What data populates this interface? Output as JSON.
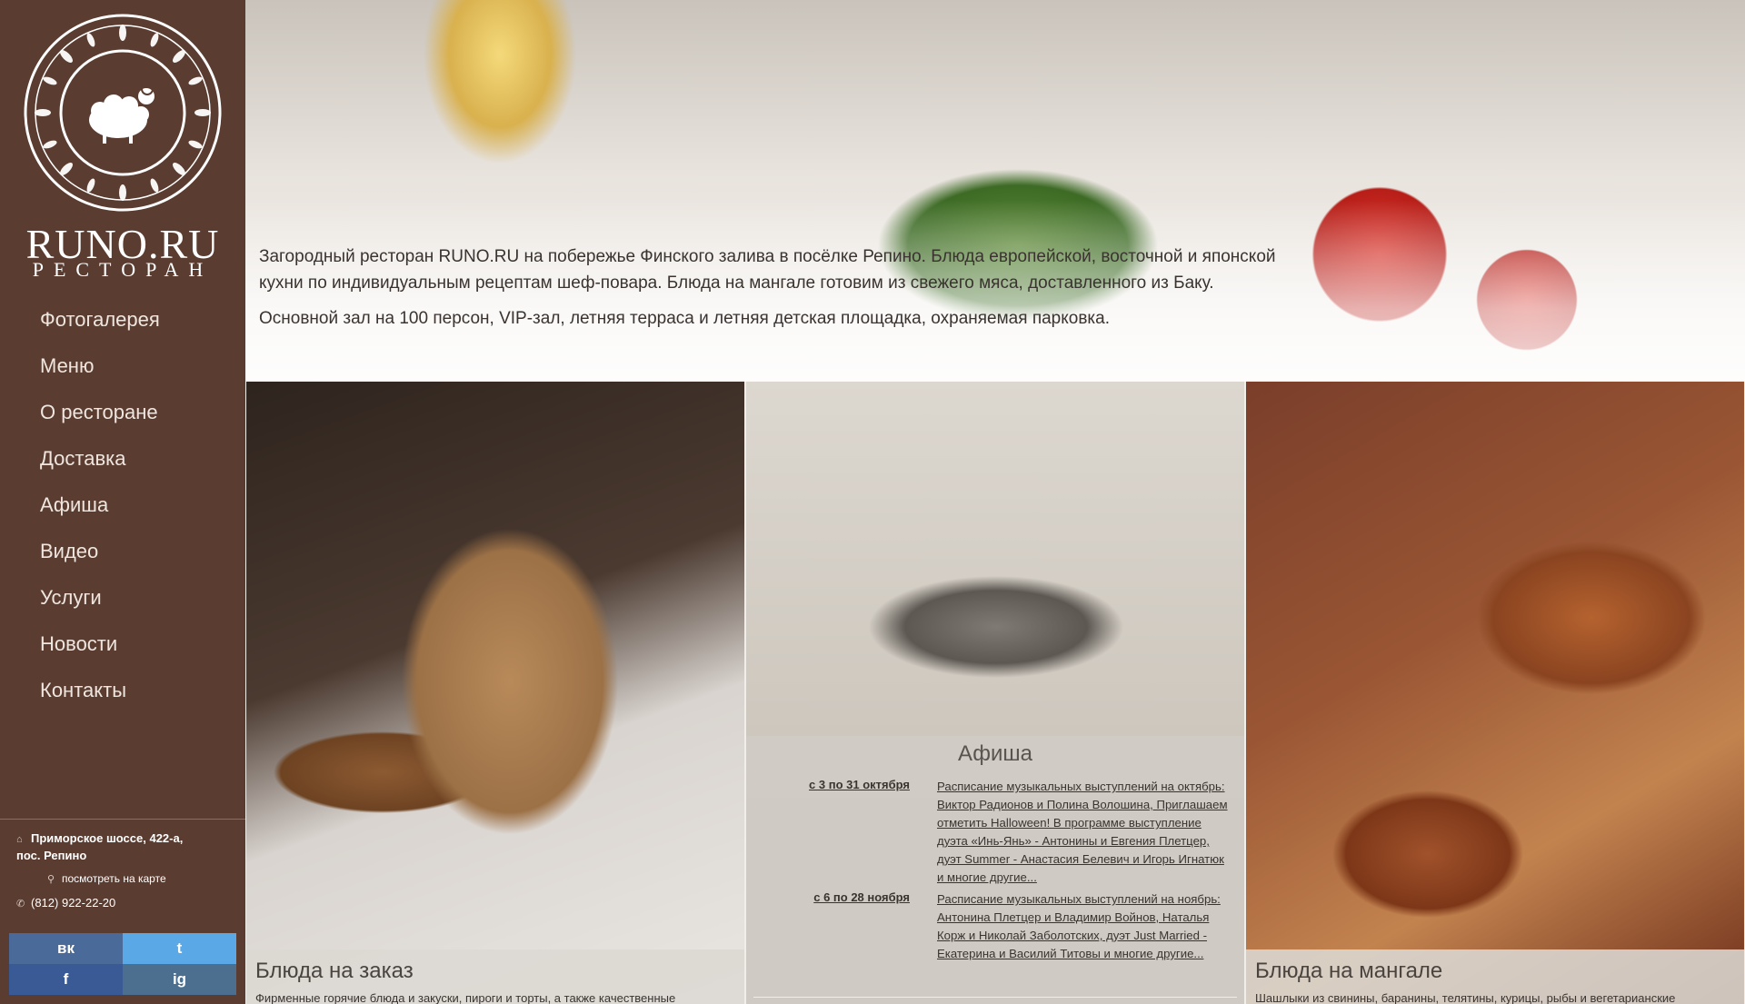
{
  "brand": {
    "name": "RUNO.RU",
    "subtitle": "РЕСТОРАН"
  },
  "nav": [
    {
      "label": "Фотогалерея"
    },
    {
      "label": "Меню"
    },
    {
      "label": "О ресторане"
    },
    {
      "label": "Доставка"
    },
    {
      "label": "Афиша"
    },
    {
      "label": "Видео"
    },
    {
      "label": "Услуги"
    },
    {
      "label": "Новости"
    },
    {
      "label": "Контакты"
    }
  ],
  "contact": {
    "address_line1": "Приморское шоссе, 422-а,",
    "address_line2": "пос. Репино",
    "map_link": "посмотреть на карте",
    "phone": "(812) 922-22-20"
  },
  "social": {
    "vk": "вк",
    "twitter": "t",
    "facebook": "f",
    "instagram": "ig"
  },
  "hero": {
    "p1": "Загородный ресторан RUNO.RU на побережье Финского залива в посёлке Репино. Блюда европейской, восточной и японской кухни по индивидуальным рецептам шеф-повара. Блюда на мангале готовим из свежего мяса, доставленного из Баку.",
    "p2": "Основной зал на 100 персон, VIP-зал, летняя терраса и летняя детская площадка, охраняемая парковка."
  },
  "panels": {
    "order": {
      "title": "Блюда на заказ",
      "desc": "Фирменные горячие блюда и закуски, пироги и торты, а также качественные"
    },
    "afisha": {
      "title": "Афиша",
      "events": [
        {
          "date": "с 3 по 31 октября",
          "text": "Расписание музыкальных выступлений на октябрь: Виктор Радионов и Полина Волошина, Приглашаем отметить Halloween! В программе выступление дуэта «Инь-Янь» - Антонины и Евгения Плетцер, дуэт Summer - Анастасия Белевич и Игорь Игнатюк и многие другие..."
        },
        {
          "date": "с 6 по 28 ноября",
          "text": "Расписание музыкальных выступлений на ноябрь: Антонина Плетцер и Владимир Войнов, Наталья Корж и Николай Заболотских, дуэт Just Married - Екатерина и Василий Титовы и многие другие..."
        }
      ]
    },
    "grill": {
      "title": "Блюда на мангале",
      "desc": "Шашлыки из свинины, баранины, телятины, курицы, рыбы и вегетарианские"
    }
  },
  "colors": {
    "sidebar": "#5a3c30",
    "vk": "#4a6a9a",
    "twitter": "#5aa9e6",
    "facebook": "#3a5a96"
  }
}
